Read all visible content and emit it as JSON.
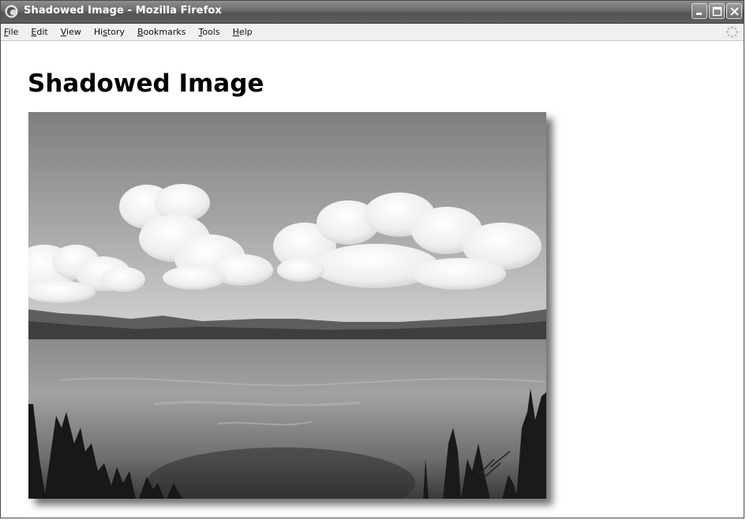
{
  "window": {
    "title": "Shadowed Image - Mozilla Firefox"
  },
  "window_buttons": [
    "minimize-icon",
    "maximize-icon",
    "close-icon"
  ],
  "menu": {
    "items": [
      {
        "label_prefix": "",
        "accel": "F",
        "label_rest": "ile"
      },
      {
        "label_prefix": "",
        "accel": "E",
        "label_rest": "dit"
      },
      {
        "label_prefix": "",
        "accel": "V",
        "label_rest": "iew"
      },
      {
        "label_prefix": "Hi",
        "accel": "s",
        "label_rest": "tory"
      },
      {
        "label_prefix": "",
        "accel": "B",
        "label_rest": "ookmarks"
      },
      {
        "label_prefix": "",
        "accel": "T",
        "label_rest": "ools"
      },
      {
        "label_prefix": "",
        "accel": "H",
        "label_rest": "elp"
      }
    ]
  },
  "page": {
    "heading": "Shadowed Image"
  },
  "image": {
    "subject": "lake-landscape-photo",
    "colors": {
      "sky_top": "#8a8a8a",
      "sky_bottom": "#c9c9c9",
      "cloud": "#f4f4f4",
      "ridge": "#5a5a5a",
      "water_light": "#9a9a9a",
      "water_dark": "#3c3c3c",
      "trees": "#1c1c1c"
    }
  }
}
